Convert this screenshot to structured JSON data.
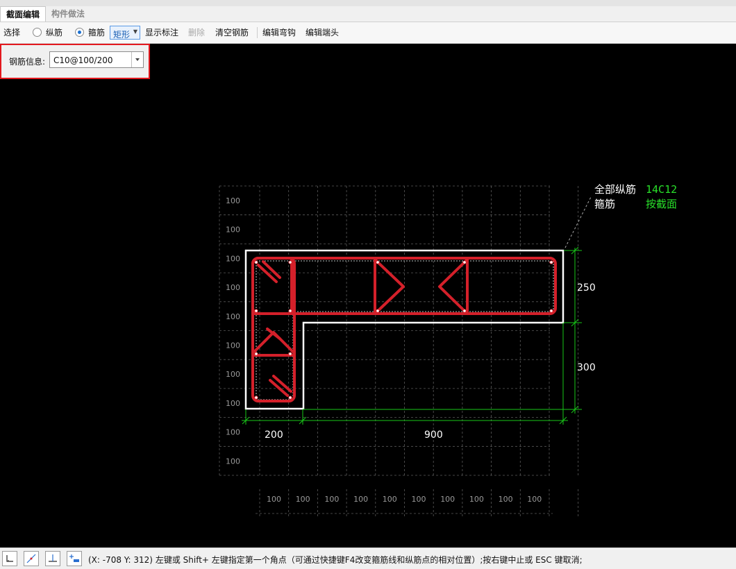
{
  "tabs": [
    {
      "label": "截面编辑",
      "active": true
    },
    {
      "label": "构件做法",
      "active": false
    }
  ],
  "toolbar": {
    "select": "选择",
    "longitudinal": "纵筋",
    "stirrup": "箍筋",
    "stirrup_selected": true,
    "shape": "矩形",
    "show_dims": "显示标注",
    "delete": "删除",
    "clear_rebar": "清空钢筋",
    "edit_hook": "编辑弯钩",
    "edit_end": "编辑端头"
  },
  "rebar_info": {
    "label": "钢筋信息:",
    "value": "C10@100/200"
  },
  "drawing": {
    "annotation": {
      "all_long_label": "全部纵筋",
      "all_long_value": "14C12",
      "stirrup_label": "箍筋",
      "stirrup_value": "按截面"
    },
    "dims": {
      "top_right": "250",
      "bottom_right": "300",
      "left_width": "200",
      "bottom_width": "900"
    },
    "grid_label": "100",
    "colors": {
      "rebar": "#d4202a",
      "dim": "#19c719",
      "outline": "#ffffff",
      "annotation_value": "#29e02a",
      "grid": "#5a5a5a"
    }
  },
  "status": {
    "coords": "(X: -708 Y: 312)",
    "message": "左键或 Shift+ 左键指定第一个角点（可通过快捷键F4改变箍筋线和纵筋点的相对位置）;按右键中止或 ESC 键取消;"
  },
  "status_icons": [
    "corner-snap-icon",
    "diagonal-line-icon",
    "perpendicular-icon",
    "add-point-icon"
  ]
}
